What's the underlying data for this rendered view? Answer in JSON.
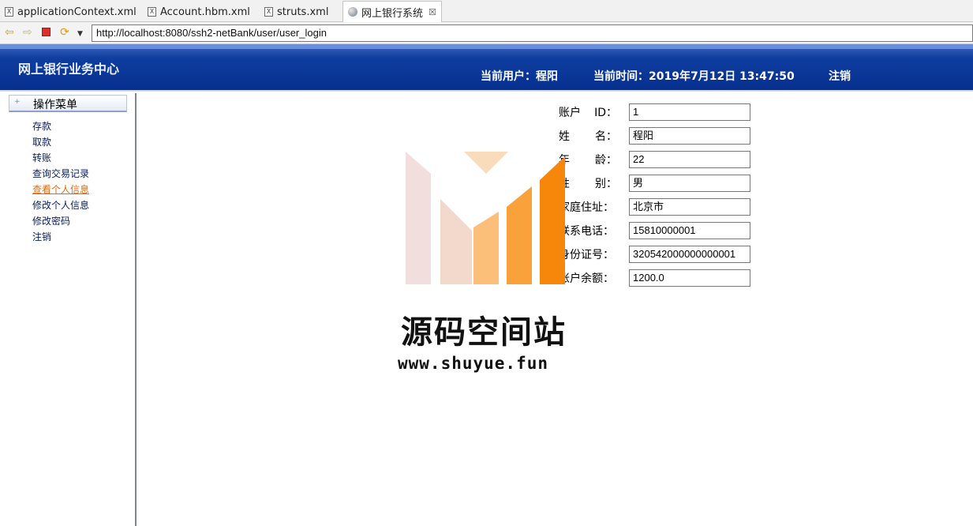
{
  "editor_tabs": [
    {
      "label": "applicationContext.xml",
      "icon": "xml-file-icon"
    },
    {
      "label": "Account.hbm.xml",
      "icon": "xml-file-icon"
    },
    {
      "label": "struts.xml",
      "icon": "xml-file-icon"
    },
    {
      "label": "网上银行系统",
      "icon": "globe-icon",
      "active": true,
      "close": "☒"
    }
  ],
  "toolbar": {
    "url": "http://localhost:8080/ssh2-netBank/user/user_login"
  },
  "header": {
    "site_title": "网上银行业务中心",
    "current_user": "当前用户：程阳",
    "current_time": "当前时间：2019年7月12日 13:47:50",
    "logout": "注销",
    "bg_color": "#0a3592"
  },
  "sidebar": {
    "title": "操作菜单",
    "items": [
      {
        "label": "存款"
      },
      {
        "label": "取款"
      },
      {
        "label": "转账"
      },
      {
        "label": "查询交易记录"
      },
      {
        "label": "查看个人信息",
        "active": true
      },
      {
        "label": "修改个人信息"
      },
      {
        "label": "修改密码"
      },
      {
        "label": "注销"
      }
    ],
    "link_color": "#0a1d5c",
    "active_color": "#e06b12"
  },
  "form": {
    "fields": [
      {
        "label_left": "账户",
        "label_right": "ID：",
        "value": "1"
      },
      {
        "label_left": "姓",
        "label_right": "名：",
        "value": "程阳"
      },
      {
        "label_left": "年",
        "label_right": "龄：",
        "value": "22"
      },
      {
        "label_left": "性",
        "label_right": "别：",
        "value": "男"
      },
      {
        "label_left": "家庭住址：",
        "label_right": "",
        "value": "北京市"
      },
      {
        "label_left": "联系电话：",
        "label_right": "",
        "value": "15810000001"
      },
      {
        "label_left": "身份证号：",
        "label_right": "",
        "value": "320542000000000001"
      },
      {
        "label_left": "账户余额：",
        "label_right": "",
        "value": "1200.0"
      }
    ]
  },
  "watermark": {
    "title": "源码空间站",
    "url": "www.shuyue.fun",
    "accent": "#f7941d"
  }
}
